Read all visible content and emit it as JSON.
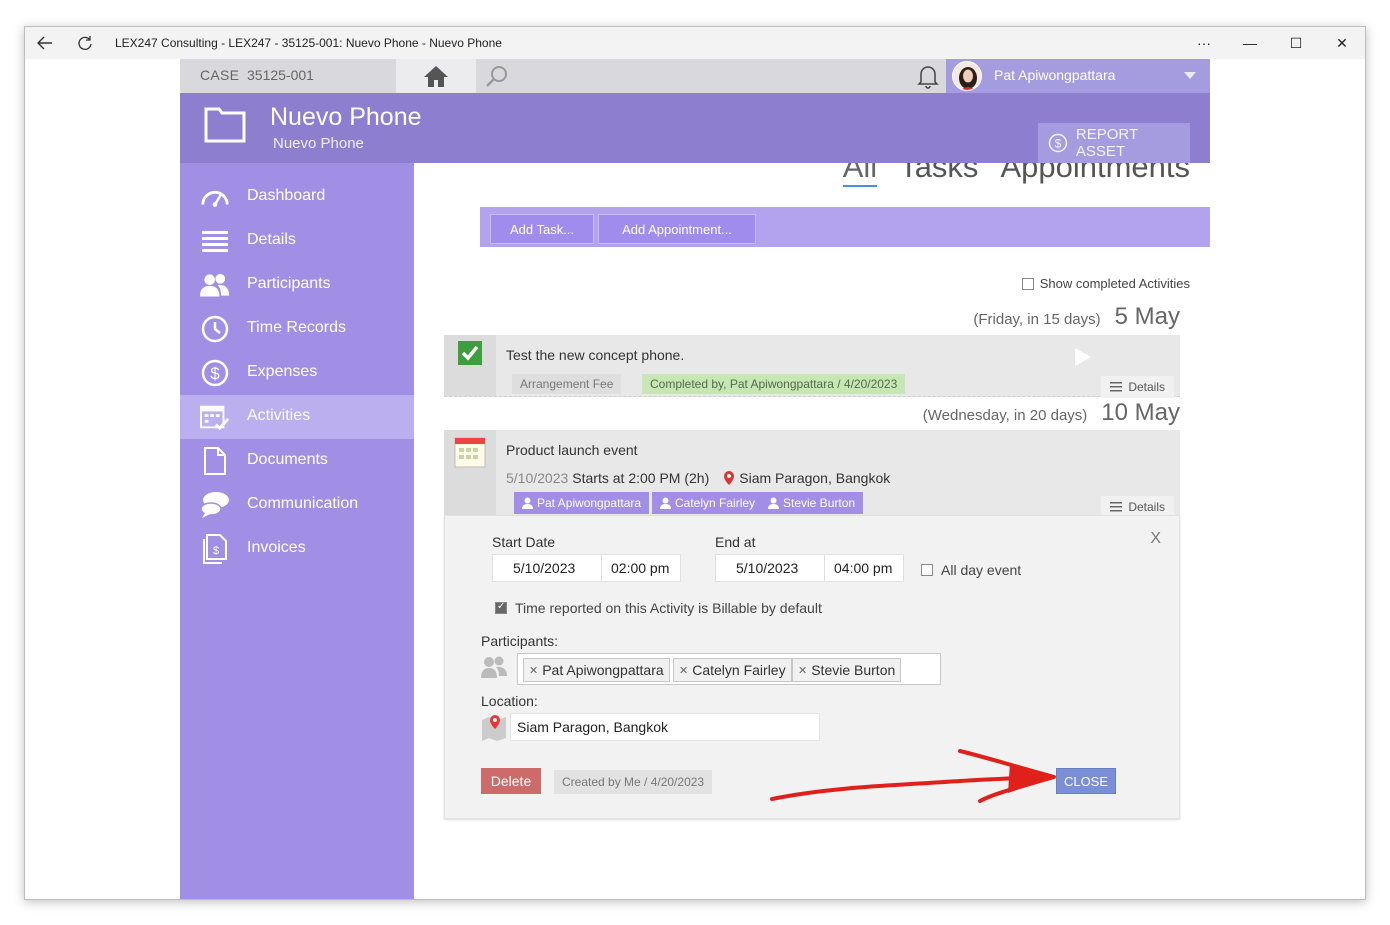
{
  "window": {
    "title": "LEX247 Consulting - LEX247 - 35125-001: Nuevo Phone - Nuevo Phone",
    "more_label": "···",
    "minimize_label": "—",
    "maximize_label": "☐",
    "close_label": "✕"
  },
  "topbar": {
    "case_label": "CASE",
    "case_id": "35125-001",
    "user_name": "Pat Apiwongpattara"
  },
  "header": {
    "title": "Nuevo Phone",
    "subtitle": "Nuevo Phone",
    "report_label": "REPORT ASSET"
  },
  "sidebar": {
    "items": [
      {
        "label": "Dashboard",
        "icon": "dashboard-icon"
      },
      {
        "label": "Details",
        "icon": "list-icon"
      },
      {
        "label": "Participants",
        "icon": "people-icon"
      },
      {
        "label": "Time Records",
        "icon": "clock-icon"
      },
      {
        "label": "Expenses",
        "icon": "dollar-icon"
      },
      {
        "label": "Activities",
        "icon": "calendar-icon",
        "active": true
      },
      {
        "label": "Documents",
        "icon": "document-icon"
      },
      {
        "label": "Communication",
        "icon": "chat-icon"
      },
      {
        "label": "Invoices",
        "icon": "invoice-icon"
      }
    ]
  },
  "tabs": [
    "All",
    "Tasks",
    "Appointments"
  ],
  "actions": {
    "add_task": "Add Task...",
    "add_appointment": "Add Appointment..."
  },
  "show_completed_label": "Show completed Activities",
  "groups": [
    {
      "relative": "(Friday, in 15 days)",
      "date": "5 May",
      "activity": {
        "title": "Test the new concept phone.",
        "tag": "Arrangement Fee",
        "status": "Completed by, Pat Apiwongpattara / 4/20/2023",
        "details_label": "Details"
      }
    },
    {
      "relative": "(Wednesday, in 20 days)",
      "date": "10 May",
      "activity": {
        "title": "Product launch event",
        "date_text": "5/10/2023",
        "time_text": "Starts at 2:00 PM (2h)",
        "location": "Siam Paragon, Bangkok",
        "participants": [
          "Pat Apiwongpattara",
          "Catelyn Fairley",
          "Stevie Burton"
        ],
        "details_label": "Details"
      }
    }
  ],
  "editor": {
    "start_label": "Start Date",
    "start_date": "5/10/2023",
    "start_time": "02:00 pm",
    "end_label": "End at",
    "end_date": "5/10/2023",
    "end_time": "04:00 pm",
    "all_day_label": "All day event",
    "billable_label": "Time reported on this Activity is Billable by default",
    "participants_label": "Participants:",
    "participants": [
      "Pat Apiwongpattara",
      "Catelyn Fairley",
      "Stevie Burton"
    ],
    "location_label": "Location:",
    "location_value": "Siam Paragon, Bangkok",
    "delete_label": "Delete",
    "created_label": "Created by Me / 4/20/2023",
    "close_label": "CLOSE",
    "dismiss_label": "X"
  },
  "colors": {
    "header": "#8e7ecf",
    "sidebar": "#a18fe6",
    "action_bar": "#b3a3ee",
    "complete_tag": "#c6e6b4",
    "delete": "#cd6a6a",
    "close": "#7b8fd6",
    "annotation_arrow": "#e0201b"
  }
}
